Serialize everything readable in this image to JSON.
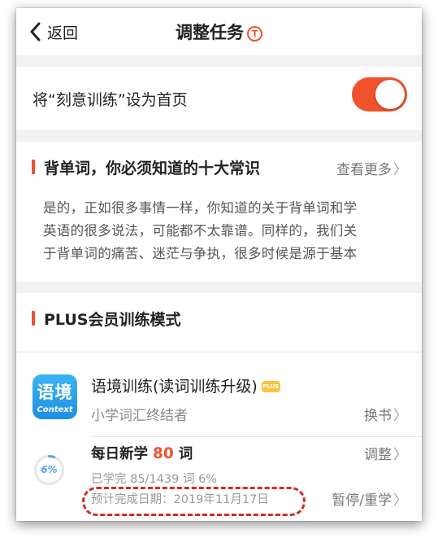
{
  "nav": {
    "back_label": "返回",
    "title": "调整任务",
    "title_badge": "T"
  },
  "home_setting": {
    "label": "将“刻意训练”设为首页",
    "enabled": true
  },
  "article": {
    "title": "背单词，你必须知道的十大常识",
    "see_more": "查看更多",
    "lines": [
      "是的，正如很多事情一样，你知道的关于背单词和学",
      "英语的很多说法，可能都不太靠谱。同样的，我们关",
      "于背单词的痛苦、迷茫与争执，很多时候是源于基本"
    ]
  },
  "plus": {
    "section_title": "PLUS会员训练模式",
    "book": {
      "icon_cn": "语境",
      "icon_en": "Context",
      "title": "语境训练(读词训练升级)",
      "badge": "PLUS",
      "subtitle": "小学词汇终结者",
      "change_label": "换书"
    },
    "daily": {
      "prefix": "每日新学",
      "count": "80",
      "unit": "词",
      "adjust_label": "调整",
      "learned_text": "已学完 85/1439 词 6%",
      "progress_fraction": 0.06,
      "progress_label": "6%",
      "finish_text": "预计完成日期：2019年11月17日",
      "pause_label": "暂停/重学"
    }
  },
  "colors": {
    "accent": "#f0522e",
    "progress": "#5aa5e6",
    "annotation": "#d32a22"
  }
}
